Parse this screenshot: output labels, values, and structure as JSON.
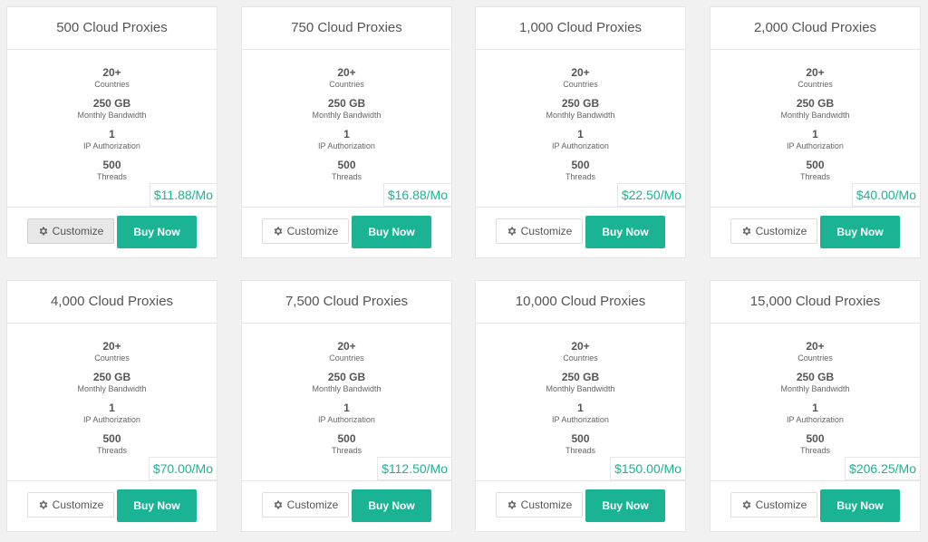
{
  "plans": [
    {
      "title": "500 Cloud Proxies",
      "price": "$11.88/Mo"
    },
    {
      "title": "750 Cloud Proxies",
      "price": "$16.88/Mo"
    },
    {
      "title": "1,000 Cloud Proxies",
      "price": "$22.50/Mo"
    },
    {
      "title": "2,000 Cloud Proxies",
      "price": "$40.00/Mo"
    },
    {
      "title": "4,000 Cloud Proxies",
      "price": "$70.00/Mo"
    },
    {
      "title": "7,500 Cloud Proxies",
      "price": "$112.50/Mo"
    },
    {
      "title": "10,000 Cloud Proxies",
      "price": "$150.00/Mo"
    },
    {
      "title": "15,000 Cloud Proxies",
      "price": "$206.25/Mo"
    }
  ],
  "specs": [
    {
      "value": "20+",
      "label": "Countries"
    },
    {
      "value": "250 GB",
      "label": "Monthly Bandwidth"
    },
    {
      "value": "1",
      "label": "IP Authorization"
    },
    {
      "value": "500",
      "label": "Threads"
    }
  ],
  "buttons": {
    "customize": "Customize",
    "buy": "Buy Now"
  },
  "icons": {
    "customize": "gear-icon"
  },
  "colors": {
    "accent": "#1ab394",
    "background": "#f1f1f1"
  },
  "ui_state": {
    "customize_pressed_card": 0
  }
}
